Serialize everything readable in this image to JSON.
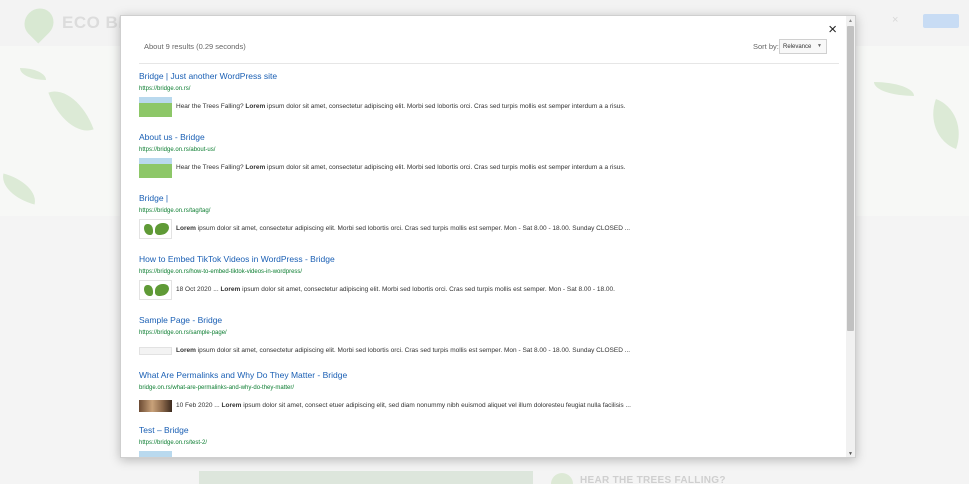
{
  "background": {
    "brand": "ECO BRI",
    "search_clear": "×",
    "section_heading": "HEAR THE TREES FALLING?"
  },
  "modal": {
    "close_label": "×",
    "results_info": "About 9 results (0.29 seconds)",
    "sort_label": "Sort by:",
    "sort_value": "Relevance",
    "results": [
      {
        "title": "Bridge | Just another WordPress site",
        "url": "https://bridge.on.rs/",
        "thumb": "grass-thumbnail",
        "prefix": "Hear the Trees Falling? ",
        "bold": "Lorem",
        "text": " ipsum dolor sit amet, consectetur adipiscing elit. Morbi sed lobortis orci. Cras sed turpis mollis est semper interdum a a risus."
      },
      {
        "title": "About us - Bridge",
        "url": "https://bridge.on.rs/about-us/",
        "thumb": "grass-thumbnail",
        "prefix": "Hear the Trees Falling? ",
        "bold": "Lorem",
        "text": " ipsum dolor sit amet, consectetur adipiscing elit. Morbi sed lobortis orci. Cras sed turpis mollis est semper interdum a a risus."
      },
      {
        "title": "Bridge |",
        "url": "https://bridge.on.rs/tag/tag/",
        "thumb": "world-map-thumbnail",
        "prefix": "",
        "bold": "Lorem",
        "text": " ipsum dolor sit amet, consectetur adipiscing elit. Morbi sed lobortis orci. Cras sed turpis mollis est semper. Mon - Sat 8.00 - 18.00. Sunday CLOSED ..."
      },
      {
        "title": "How to Embed TikTok Videos in WordPress - Bridge",
        "url": "https://bridge.on.rs/how-to-embed-tiktok-videos-in-wordpress/",
        "thumb": "world-map-thumbnail",
        "prefix": "18 Oct 2020 ... ",
        "bold": "Lorem",
        "text": " ipsum dolor sit amet, consectetur adipiscing elit. Morbi sed lobortis orci. Cras sed turpis mollis est semper. Mon - Sat 8.00 - 18.00."
      },
      {
        "title": "Sample Page - Bridge",
        "url": "https://bridge.on.rs/sample-page/",
        "thumb": "blank-thumbnail",
        "prefix": "",
        "bold": "Lorem",
        "text": " ipsum dolor sit amet, consectetur adipiscing elit. Morbi sed lobortis orci. Cras sed turpis mollis est semper. Mon - Sat 8.00 - 18.00. Sunday CLOSED ..."
      },
      {
        "title": "What Are Permalinks and Why Do They Matter - Bridge",
        "url": "bridge.on.rs/what-are-permalinks-and-why-do-they-matter/",
        "thumb": "photo-thumbnail",
        "prefix": "10 Feb 2020 ... ",
        "bold": "Lorem",
        "text": " ipsum dolor sit amet, consect etuer adipiscing elit, sed diam nonummy nibh euismod aliquet vel illum doloresteu feugiat nulla facilisis ..."
      },
      {
        "title": "Test – Bridge",
        "url": "https://bridge.on.rs/test-2/",
        "thumb": "grass-thumbnail",
        "prefix": "",
        "bold": "",
        "text": ""
      }
    ]
  }
}
